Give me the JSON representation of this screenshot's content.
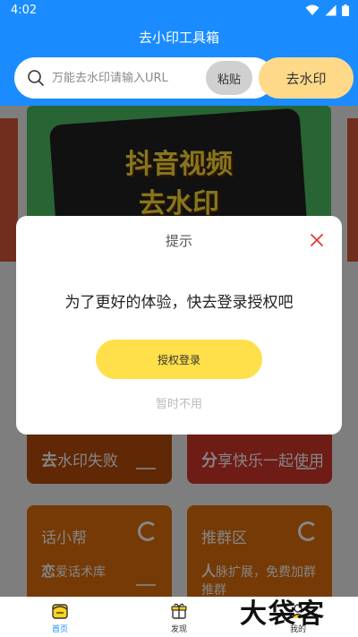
{
  "status_bar": {
    "time": "4:02"
  },
  "app": {
    "title": "去小印工具箱"
  },
  "search": {
    "placeholder": "万能去水印请输入URL",
    "paste_label": "粘贴",
    "submit_label": "去水印"
  },
  "banner": {
    "line1": "抖音视频",
    "line2": "去水印"
  },
  "cards": [
    {
      "head_char": "去",
      "head_rest": "水印失败"
    },
    {
      "head_char": "分",
      "head_rest": "享快乐一起使用"
    },
    {
      "title": "话小帮",
      "sub_char": "恋",
      "sub_rest": "爱话术库"
    },
    {
      "title": "推群区",
      "sub_char": "人",
      "sub_rest": "脉扩展，免费加群推群"
    }
  ],
  "dialog": {
    "title": "提示",
    "message": "为了更好的体验，快去登录授权吧",
    "auth_button": "授权登录",
    "later_link": "暂时不用"
  },
  "bottom_nav": {
    "items": [
      {
        "label": "首页",
        "icon": "home-icon",
        "active": true
      },
      {
        "label": "发现",
        "icon": "gift-icon",
        "active": false
      },
      {
        "label": "我的",
        "icon": "profile-icon",
        "active": false
      }
    ]
  },
  "watermark": "大袋客",
  "colors": {
    "primary": "#1a8cff",
    "accent": "#ffdf4a",
    "submit_bg": "#ffd98a",
    "close_red": "#e53935"
  }
}
